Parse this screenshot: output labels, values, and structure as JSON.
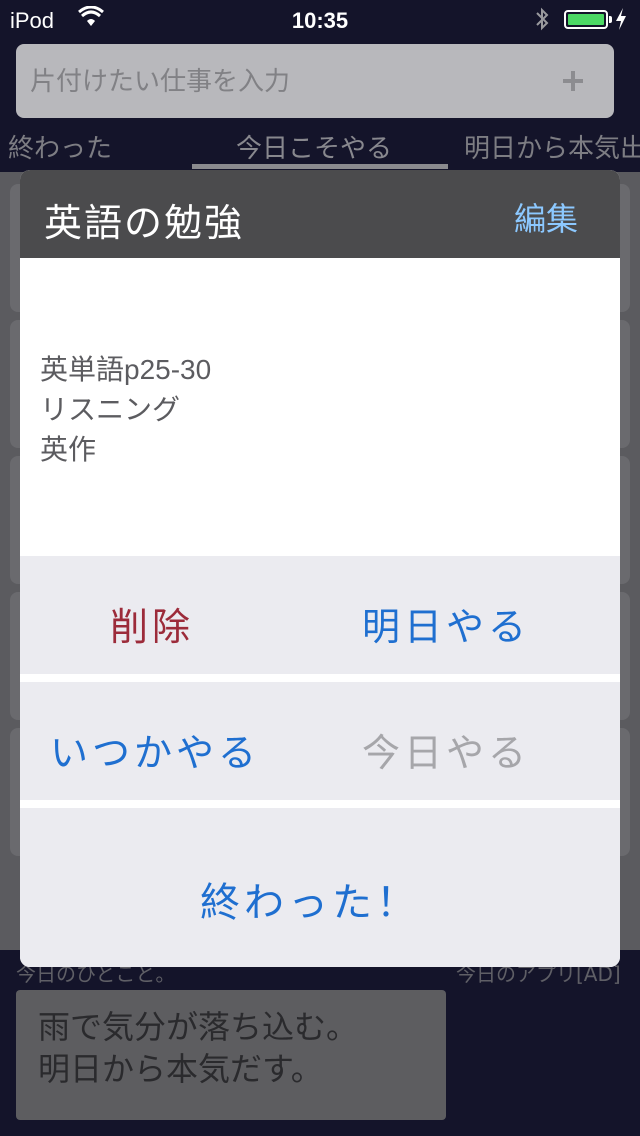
{
  "status_bar": {
    "carrier": "iPod",
    "time": "10:35",
    "wifi_icon": "wifi-icon",
    "bluetooth_icon": "bluetooth-icon",
    "battery_icon": "battery-icon",
    "battery_level": 1.0,
    "battery_color": "#4cd964"
  },
  "task_input": {
    "placeholder": "片付けたい仕事を入力",
    "add_icon": "plus-icon"
  },
  "tabs": [
    {
      "label": "終わった"
    },
    {
      "label": "今日こそやる"
    },
    {
      "label": "明日から本気出"
    }
  ],
  "modal": {
    "title": "英語の勉強",
    "edit_label": "編集",
    "task_lines": [
      "英単語p25-30",
      "リスニング",
      "英作"
    ],
    "actions": {
      "delete": "削除",
      "tomorrow": "明日やる",
      "someday": "いつかやる",
      "today": "今日やる",
      "done": "終わった！"
    }
  },
  "bottom": {
    "left_label": "今日のひとこと。",
    "right_label": "今日のアプリ[AD]",
    "memo": "雨で気分が落ち込む。\n明日から本気だす。"
  },
  "colors": {
    "accent_blue": "#1f6fd0",
    "delete_red": "#9c2b3a",
    "edit_link": "#8cc8ff",
    "header_bg": "#4b4b4d"
  }
}
